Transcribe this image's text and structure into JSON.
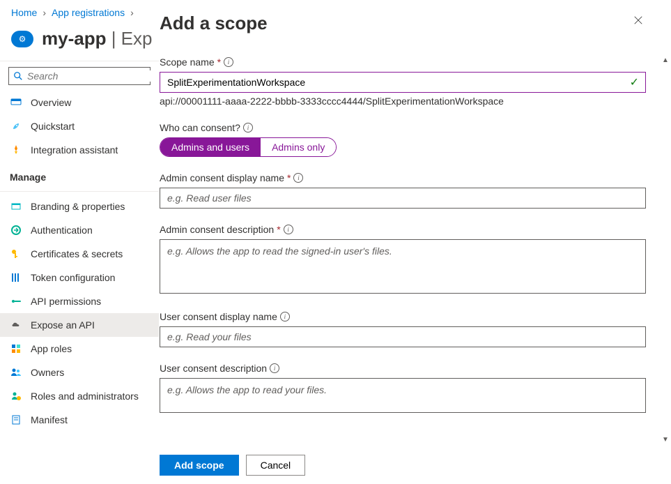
{
  "breadcrumb": {
    "home": "Home",
    "appReg": "App registrations"
  },
  "header": {
    "app_name": "my-app",
    "sep": " | ",
    "sub": "Exp"
  },
  "search": {
    "placeholder": "Search"
  },
  "nav": {
    "overview": "Overview",
    "quickstart": "Quickstart",
    "integration": "Integration assistant",
    "manage_header": "Manage",
    "branding": "Branding & properties",
    "authentication": "Authentication",
    "certificates": "Certificates & secrets",
    "token": "Token configuration",
    "permissions": "API permissions",
    "expose": "Expose an API",
    "roles": "App roles",
    "owners": "Owners",
    "admins": "Roles and administrators",
    "manifest": "Manifest"
  },
  "panel": {
    "title": "Add a scope",
    "scope_name_label": "Scope name",
    "scope_name_value": "SplitExperimentationWorkspace",
    "scope_uri": "api://00001111-aaaa-2222-bbbb-3333cccc4444/SplitExperimentationWorkspace",
    "consent_label": "Who can consent?",
    "consent_option1": "Admins and users",
    "consent_option2": "Admins only",
    "admin_display_label": "Admin consent display name",
    "admin_display_ph": "e.g. Read user files",
    "admin_desc_label": "Admin consent description",
    "admin_desc_ph": "e.g. Allows the app to read the signed-in user's files.",
    "user_display_label": "User consent display name",
    "user_display_ph": "e.g. Read your files",
    "user_desc_label": "User consent description",
    "user_desc_ph": "e.g. Allows the app to read your files.",
    "add_btn": "Add scope",
    "cancel_btn": "Cancel"
  }
}
